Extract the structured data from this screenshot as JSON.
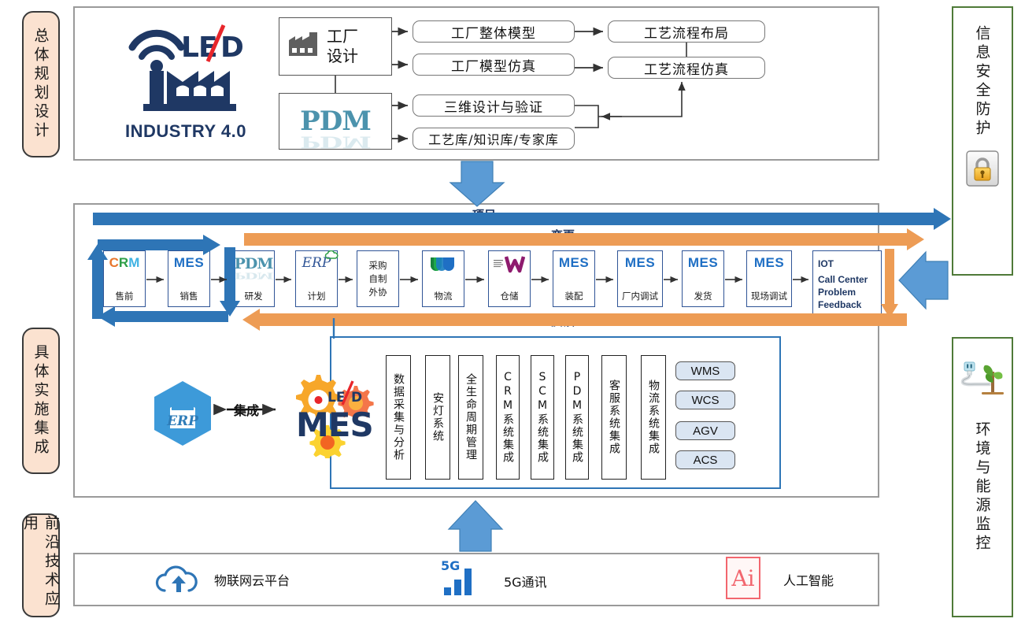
{
  "stages": [
    {
      "label": "总体规划设计"
    },
    {
      "label": "具体实施集成"
    },
    {
      "label": "前沿技术应用"
    }
  ],
  "side_panels": [
    {
      "label": "信息安全防护",
      "icon": "lock-icon"
    },
    {
      "label": "环境与能源监控",
      "icon": "plant-plug-icon"
    }
  ],
  "planning": {
    "logo": {
      "brand": "LEAD",
      "tagline": "INDUSTRY 4.0",
      "icon": "factory-wifi-icon"
    },
    "source_boxes": [
      {
        "id": "factory-design",
        "label_top": "工厂",
        "label_bottom": "设计",
        "icon": "factory-icon"
      },
      {
        "id": "pdm",
        "label": "PDM",
        "icon": "pdm-icon"
      }
    ],
    "mid_boxes": [
      {
        "label": "工厂整体模型"
      },
      {
        "label": "工厂模型仿真"
      },
      {
        "label": "三维设计与验证"
      },
      {
        "label": "工艺库/知识库/专家库"
      }
    ],
    "right_boxes": [
      {
        "label": "工艺流程布局"
      },
      {
        "label": "工艺流程仿真"
      }
    ]
  },
  "implementation": {
    "bands": [
      {
        "label": "项目",
        "color": "#2e75b6",
        "direction": "right"
      },
      {
        "label": "变更",
        "color": "#ed9c55",
        "direction": "right"
      },
      {
        "label": "反馈",
        "color": "#ed9c55",
        "direction": "left"
      }
    ],
    "process": [
      {
        "top": "CRM",
        "bottom": "售前",
        "icon": "crm-icon"
      },
      {
        "top": "MES",
        "bottom": "销售",
        "icon": "mes-icon"
      },
      {
        "top": "PDM",
        "bottom": "研发",
        "icon": "pdm-icon"
      },
      {
        "top": "ERP",
        "bottom": "计划",
        "icon": "erp-cloud-icon"
      },
      {
        "top": "采购\n自制\n外协",
        "bottom": "",
        "icon": "text-icon"
      },
      {
        "top": "",
        "bottom": "物流",
        "icon": "logistics-w-icon"
      },
      {
        "top": "",
        "bottom": "仓储",
        "icon": "warehouse-w-icon"
      },
      {
        "top": "MES",
        "bottom": "装配",
        "icon": "mes-icon"
      },
      {
        "top": "MES",
        "bottom": "厂内调试",
        "icon": "mes-icon"
      },
      {
        "top": "MES",
        "bottom": "发货",
        "icon": "mes-icon"
      },
      {
        "top": "MES",
        "bottom": "现场调试",
        "icon": "mes-icon"
      }
    ],
    "procurement_lines": [
      "采购",
      "自制",
      "外协"
    ],
    "iot_card": {
      "lines": [
        "IOT",
        "Call Center",
        "Problem",
        "Feedback"
      ]
    },
    "integration": {
      "erp_label": "ERP",
      "link_label": "集成",
      "mes_brand": "MES",
      "mes_lead": "LEAD",
      "strips": [
        "数据采集与分析",
        "安灯系统",
        "全生命周期管理",
        "CRM系统集成",
        "SCM系统集成",
        "PDM系统集成",
        "客服系统集成",
        "物流系统集成"
      ],
      "pills": [
        "WMS",
        "WCS",
        "AGV",
        "ACS"
      ]
    }
  },
  "frontier_tech": [
    {
      "label": "物联网云平台",
      "icon": "cloud-iot-icon"
    },
    {
      "label": "5G通讯",
      "icon": "5g-signal-icon"
    },
    {
      "label": "人工智能",
      "icon": "ai-icon"
    }
  ],
  "colors": {
    "stage_bg": "#fbe2d0",
    "panel_border": "#4f7a38",
    "accent_blue": "#2e75b6",
    "accent_orange": "#ed9c55",
    "card_border": "#2f5496",
    "brand_navy": "#1f3864"
  }
}
